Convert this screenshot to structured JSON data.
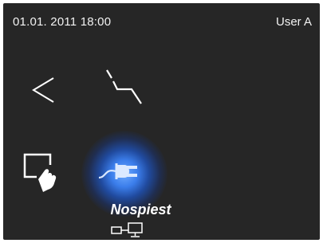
{
  "status_bar": {
    "datetime": "01.01. 2011 18:00",
    "user": "User A"
  },
  "icons": {
    "back": "chevron-left-icon",
    "link": "broken-link-icon",
    "touch": "touch-screen-icon",
    "plug": "power-plug-icon",
    "network": "network-monitor-icon"
  },
  "selected_mode": {
    "label": "Nospiest"
  },
  "colors": {
    "background": "#262626",
    "foreground": "#ffffff",
    "accent_glow": "#3c82f5",
    "icon_on_glow": "#dbe9ff"
  }
}
